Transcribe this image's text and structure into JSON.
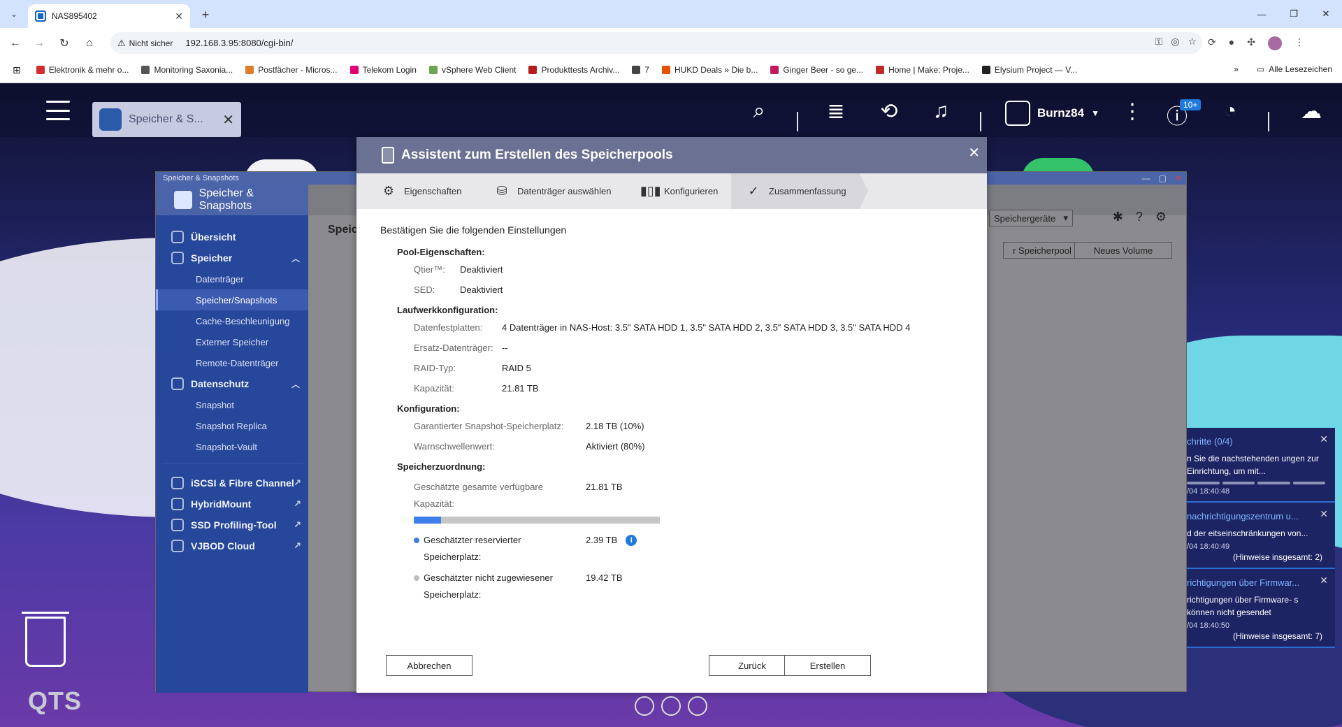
{
  "browser": {
    "tab_title": "NAS895402",
    "insecure_label": "Nicht sicher",
    "url": "192.168.3.95:8080/cgi-bin/",
    "bookmarks": [
      {
        "label": "Elektronik & mehr o...",
        "color": "#d32f2f"
      },
      {
        "label": "Monitoring Saxonia...",
        "color": "#555555"
      },
      {
        "label": "Postfächer - Micros...",
        "color": "#e07b2a"
      },
      {
        "label": "Telekom Login",
        "color": "#e20074"
      },
      {
        "label": "vSphere Web Client",
        "color": "#6aa84f"
      },
      {
        "label": "Produkttests Archiv...",
        "color": "#b71c1c"
      },
      {
        "label": "7",
        "color": "#444444"
      },
      {
        "label": "HUKD Deals » Die b...",
        "color": "#e65100"
      },
      {
        "label": "Ginger Beer - so ge...",
        "color": "#c2185b"
      },
      {
        "label": "Home | Make: Proje...",
        "color": "#c62828"
      },
      {
        "label": "Elysium Project — V...",
        "color": "#222222"
      }
    ],
    "all_bookmarks": "Alle Lesezeichen"
  },
  "qts": {
    "app_pill_label": "Speicher & S...",
    "username": "Burnz84",
    "notif_badge": "10+",
    "logo": "QTS"
  },
  "app": {
    "window_title": "Speicher & Snapshots",
    "brand": "Speicher & Snapshots",
    "crumb": "Speic",
    "right_select": "Speichergeräte",
    "btn_pool": "r Speicherpool",
    "btn_volume": "Neues Volume",
    "nav": {
      "overview": "Übersicht",
      "storage": "Speicher",
      "storage_items": [
        "Datenträger",
        "Speicher/Snapshots",
        "Cache-Beschleunigung",
        "Externer Speicher",
        "Remote-Datenträger"
      ],
      "protection": "Datenschutz",
      "protection_items": [
        "Snapshot",
        "Snapshot Replica",
        "Snapshot-Vault"
      ],
      "iscsi": "iSCSI & Fibre Channel",
      "hybridmount": "HybridMount",
      "ssd": "SSD Profiling-Tool",
      "vjbod": "VJBOD Cloud"
    }
  },
  "notifications": [
    {
      "title": "chritte (0/4)",
      "body": "n Sie die nachstehenden ungen zur Einrichtung, um mit...",
      "time": "/04 18:40:48",
      "total": ""
    },
    {
      "title": "nachrichtigungszentrum u...",
      "body": "d der eitseinschränkungen von...",
      "time": "/04 18:40:49",
      "total": "(Hinweise insgesamt: 2)"
    },
    {
      "title": "richtigungen über Firmwar...",
      "body": "richtigungen über Firmware- s können nicht gesendet",
      "time": "/04 18:40:50",
      "total": "(Hinweise insgesamt: 7)"
    }
  ],
  "modal": {
    "title": "Assistent zum Erstellen des Speicherpools",
    "steps": [
      "Eigenschaften",
      "Datenträger auswählen",
      "Konfigurieren",
      "Zusammenfassung"
    ],
    "intro": "Bestätigen Sie die folgenden Einstellungen",
    "pool": {
      "title": "Pool-Eigenschaften:",
      "qtier_label": "Qtier™:",
      "qtier_value": "Deaktiviert",
      "sed_label": "SED:",
      "sed_value": "Deaktiviert"
    },
    "drives": {
      "title": "Laufwerkkonfiguration:",
      "disks_label": "Datenfestplatten:",
      "disks_value": "4 Datenträger in NAS-Host: 3.5\" SATA HDD 1, 3.5\" SATA HDD 2, 3.5\" SATA HDD 3, 3.5\" SATA HDD 4",
      "spare_label": "Ersatz-Datenträger:",
      "spare_value": "--",
      "raid_label": "RAID-Typ:",
      "raid_value": "RAID 5",
      "cap_label": "Kapazität:",
      "cap_value": "21.81 TB"
    },
    "config": {
      "title": "Konfiguration:",
      "snap_label": "Garantierter Snapshot-Speicherplatz:",
      "snap_value": "2.18 TB (10%)",
      "warn_label": "Warnschwellenwert:",
      "warn_value": "Aktiviert (80%)"
    },
    "alloc": {
      "title": "Speicherzuordnung:",
      "total_label": "Geschätzte gesamte verfügbare Kapazität:",
      "total_value": "21.81 TB",
      "reserved_fraction": 0.11,
      "reserved_label": "Geschätzter reservierter Speicherplatz:",
      "reserved_value": "2.39 TB",
      "unalloc_label": "Geschätzter nicht zugewiesener Speicherplatz:",
      "unalloc_value": "19.42 TB",
      "reserved_color": "#3d7ee8",
      "unalloc_color": "#bdbdbd"
    },
    "buttons": {
      "cancel": "Abbrechen",
      "back": "Zurück",
      "create": "Erstellen"
    }
  }
}
